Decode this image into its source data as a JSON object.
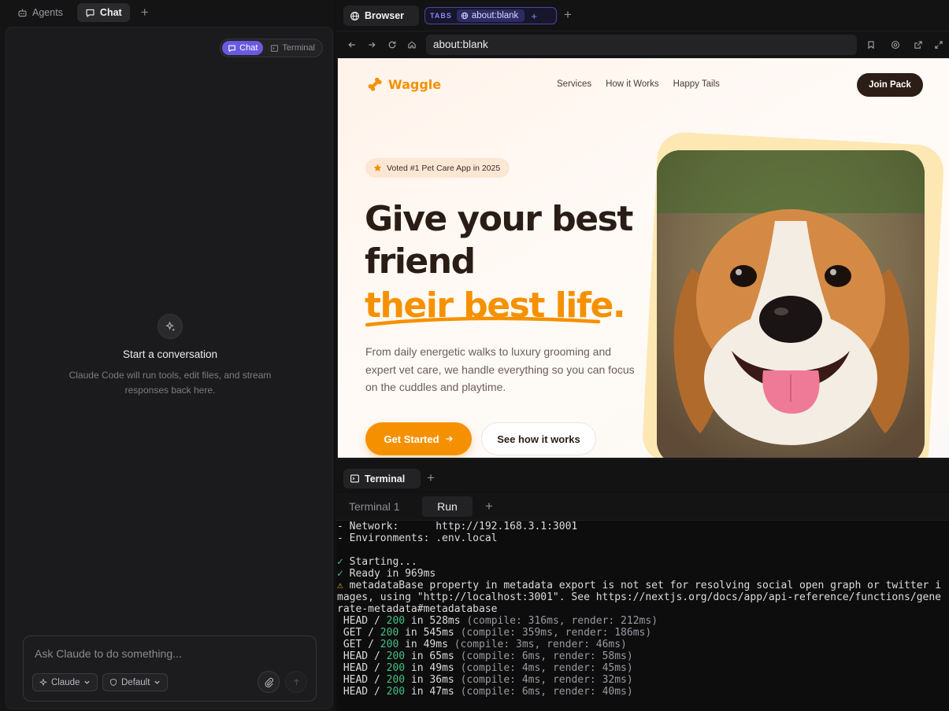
{
  "left_tabs": {
    "agents": "Agents",
    "chat": "Chat",
    "add": "+"
  },
  "chat_panel": {
    "segments": {
      "chat": "Chat",
      "terminal": "Terminal"
    },
    "empty_title": "Start a conversation",
    "empty_sub": "Claude Code will run tools, edit files, and stream responses back here.",
    "composer_placeholder": "Ask Claude to do something...",
    "model_label": "Claude",
    "mode_label": "Default"
  },
  "browser": {
    "tab_label": "Browser",
    "group_label": "TABS",
    "group_tab": "about:blank",
    "group_plus": "+",
    "add_tab": "+",
    "address": "about:blank"
  },
  "site": {
    "logo": "Waggle",
    "nav": [
      "Services",
      "How it Works",
      "Happy Tails"
    ],
    "join": "Join Pack",
    "badge": "Voted #1 Pet Care App in 2025",
    "h1_line1": "Give your best",
    "h1_line2": "friend",
    "h1_accent": "their best life.",
    "lead": "From daily energetic walks to luxury grooming and expert vet care, we handle everything so you can focus on the cuddles and playtime.",
    "cta_primary": "Get Started",
    "cta_secondary": "See how it works",
    "colors": {
      "accent": "#f59100",
      "dark": "#2c1d16"
    }
  },
  "terminal": {
    "tab_label": "Terminal",
    "add": "+",
    "subtabs": [
      "Terminal 1",
      "Run"
    ],
    "subtab_add": "+",
    "lines": {
      "network": "- Network:      http://192.168.3.1:3001",
      "env": "- Environments: .env.local",
      "starting_mark": "✓",
      "starting": " Starting...",
      "ready_mark": "✓",
      "ready": " Ready in 969ms",
      "warn_mark": "⚠",
      "warn1": " metadataBase property in metadata export is not set for resolving social open graph or twitter i",
      "warn2": "mages, using \"http://localhost:3001\". See https://nextjs.org/docs/app/api-reference/functions/gene",
      "warn3": "rate-metadata#metadatabase"
    },
    "requests": [
      {
        "method": " HEAD / ",
        "status": "200",
        "time": " in 528ms ",
        "detail": "(compile: 316ms, render: 212ms)"
      },
      {
        "method": " GET / ",
        "status": "200",
        "time": " in 545ms ",
        "detail": "(compile: 359ms, render: 186ms)"
      },
      {
        "method": " GET / ",
        "status": "200",
        "time": " in 49ms ",
        "detail": "(compile: 3ms, render: 46ms)"
      },
      {
        "method": " HEAD / ",
        "status": "200",
        "time": " in 65ms ",
        "detail": "(compile: 6ms, render: 58ms)"
      },
      {
        "method": " HEAD / ",
        "status": "200",
        "time": " in 49ms ",
        "detail": "(compile: 4ms, render: 45ms)"
      },
      {
        "method": " HEAD / ",
        "status": "200",
        "time": " in 36ms ",
        "detail": "(compile: 4ms, render: 32ms)"
      },
      {
        "method": " HEAD / ",
        "status": "200",
        "time": " in 47ms ",
        "detail": "(compile: 6ms, render: 40ms)"
      }
    ]
  }
}
